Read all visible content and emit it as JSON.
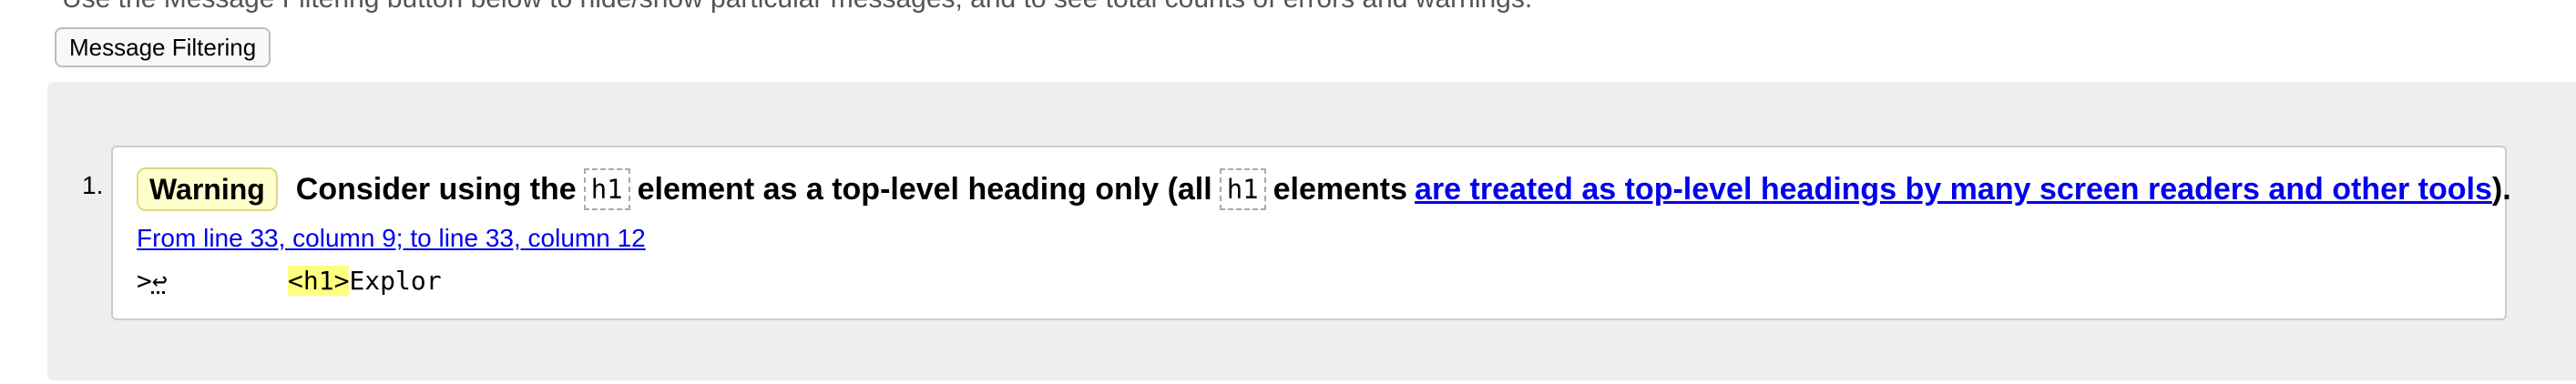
{
  "intro_text": "Use the Message Filtering button below to hide/show particular messages, and to see total counts of errors and warnings.",
  "filter_button_label": "Message Filtering",
  "messages": [
    {
      "number": "1.",
      "type": "Warning",
      "text_1": "Consider using the",
      "code_1": "h1",
      "text_2": "element as a top-level heading only (all",
      "code_2": "h1",
      "text_3": "elements",
      "link_text": "are treated as top-level headings by many screen readers and other tools",
      "text_end": ").",
      "location": "From line 33, column 9; to line 33, column 12",
      "extract_prefix": ">",
      "extract_linefeed": "↩",
      "extract_highlight": "<h1>",
      "extract_after": "Explor"
    }
  ],
  "colors": {
    "badge_background": "#ffffcc",
    "link": "#0000ee",
    "highlight": "#ffff80",
    "results_background": "#eeeeee"
  }
}
